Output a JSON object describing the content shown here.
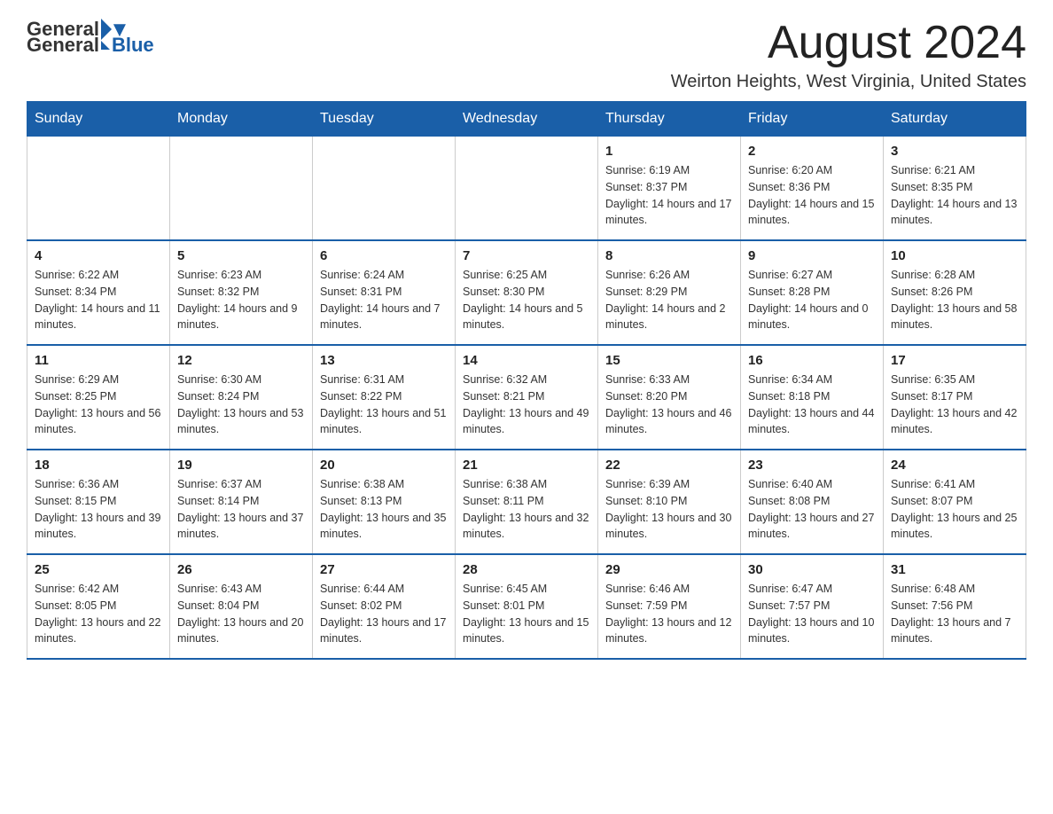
{
  "header": {
    "logo_general": "General",
    "logo_blue": "Blue",
    "month_title": "August 2024",
    "location": "Weirton Heights, West Virginia, United States"
  },
  "days_of_week": [
    "Sunday",
    "Monday",
    "Tuesday",
    "Wednesday",
    "Thursday",
    "Friday",
    "Saturday"
  ],
  "weeks": [
    [
      {
        "day": "",
        "info": ""
      },
      {
        "day": "",
        "info": ""
      },
      {
        "day": "",
        "info": ""
      },
      {
        "day": "",
        "info": ""
      },
      {
        "day": "1",
        "info": "Sunrise: 6:19 AM\nSunset: 8:37 PM\nDaylight: 14 hours and 17 minutes."
      },
      {
        "day": "2",
        "info": "Sunrise: 6:20 AM\nSunset: 8:36 PM\nDaylight: 14 hours and 15 minutes."
      },
      {
        "day": "3",
        "info": "Sunrise: 6:21 AM\nSunset: 8:35 PM\nDaylight: 14 hours and 13 minutes."
      }
    ],
    [
      {
        "day": "4",
        "info": "Sunrise: 6:22 AM\nSunset: 8:34 PM\nDaylight: 14 hours and 11 minutes."
      },
      {
        "day": "5",
        "info": "Sunrise: 6:23 AM\nSunset: 8:32 PM\nDaylight: 14 hours and 9 minutes."
      },
      {
        "day": "6",
        "info": "Sunrise: 6:24 AM\nSunset: 8:31 PM\nDaylight: 14 hours and 7 minutes."
      },
      {
        "day": "7",
        "info": "Sunrise: 6:25 AM\nSunset: 8:30 PM\nDaylight: 14 hours and 5 minutes."
      },
      {
        "day": "8",
        "info": "Sunrise: 6:26 AM\nSunset: 8:29 PM\nDaylight: 14 hours and 2 minutes."
      },
      {
        "day": "9",
        "info": "Sunrise: 6:27 AM\nSunset: 8:28 PM\nDaylight: 14 hours and 0 minutes."
      },
      {
        "day": "10",
        "info": "Sunrise: 6:28 AM\nSunset: 8:26 PM\nDaylight: 13 hours and 58 minutes."
      }
    ],
    [
      {
        "day": "11",
        "info": "Sunrise: 6:29 AM\nSunset: 8:25 PM\nDaylight: 13 hours and 56 minutes."
      },
      {
        "day": "12",
        "info": "Sunrise: 6:30 AM\nSunset: 8:24 PM\nDaylight: 13 hours and 53 minutes."
      },
      {
        "day": "13",
        "info": "Sunrise: 6:31 AM\nSunset: 8:22 PM\nDaylight: 13 hours and 51 minutes."
      },
      {
        "day": "14",
        "info": "Sunrise: 6:32 AM\nSunset: 8:21 PM\nDaylight: 13 hours and 49 minutes."
      },
      {
        "day": "15",
        "info": "Sunrise: 6:33 AM\nSunset: 8:20 PM\nDaylight: 13 hours and 46 minutes."
      },
      {
        "day": "16",
        "info": "Sunrise: 6:34 AM\nSunset: 8:18 PM\nDaylight: 13 hours and 44 minutes."
      },
      {
        "day": "17",
        "info": "Sunrise: 6:35 AM\nSunset: 8:17 PM\nDaylight: 13 hours and 42 minutes."
      }
    ],
    [
      {
        "day": "18",
        "info": "Sunrise: 6:36 AM\nSunset: 8:15 PM\nDaylight: 13 hours and 39 minutes."
      },
      {
        "day": "19",
        "info": "Sunrise: 6:37 AM\nSunset: 8:14 PM\nDaylight: 13 hours and 37 minutes."
      },
      {
        "day": "20",
        "info": "Sunrise: 6:38 AM\nSunset: 8:13 PM\nDaylight: 13 hours and 35 minutes."
      },
      {
        "day": "21",
        "info": "Sunrise: 6:38 AM\nSunset: 8:11 PM\nDaylight: 13 hours and 32 minutes."
      },
      {
        "day": "22",
        "info": "Sunrise: 6:39 AM\nSunset: 8:10 PM\nDaylight: 13 hours and 30 minutes."
      },
      {
        "day": "23",
        "info": "Sunrise: 6:40 AM\nSunset: 8:08 PM\nDaylight: 13 hours and 27 minutes."
      },
      {
        "day": "24",
        "info": "Sunrise: 6:41 AM\nSunset: 8:07 PM\nDaylight: 13 hours and 25 minutes."
      }
    ],
    [
      {
        "day": "25",
        "info": "Sunrise: 6:42 AM\nSunset: 8:05 PM\nDaylight: 13 hours and 22 minutes."
      },
      {
        "day": "26",
        "info": "Sunrise: 6:43 AM\nSunset: 8:04 PM\nDaylight: 13 hours and 20 minutes."
      },
      {
        "day": "27",
        "info": "Sunrise: 6:44 AM\nSunset: 8:02 PM\nDaylight: 13 hours and 17 minutes."
      },
      {
        "day": "28",
        "info": "Sunrise: 6:45 AM\nSunset: 8:01 PM\nDaylight: 13 hours and 15 minutes."
      },
      {
        "day": "29",
        "info": "Sunrise: 6:46 AM\nSunset: 7:59 PM\nDaylight: 13 hours and 12 minutes."
      },
      {
        "day": "30",
        "info": "Sunrise: 6:47 AM\nSunset: 7:57 PM\nDaylight: 13 hours and 10 minutes."
      },
      {
        "day": "31",
        "info": "Sunrise: 6:48 AM\nSunset: 7:56 PM\nDaylight: 13 hours and 7 minutes."
      }
    ]
  ]
}
